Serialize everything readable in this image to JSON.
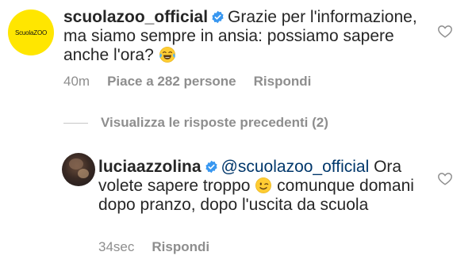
{
  "comment_main": {
    "username": "scuolazoo_official",
    "text": "Grazie per l'informazione, ma siamo sempre in ansia: possiamo sapere anche l'ora?",
    "emoji": "face-with-tears-of-joy",
    "avatar_logo": "ScuolaZOO",
    "time": "40m",
    "likes": "Piace a 282 persone",
    "reply": "Rispondi"
  },
  "view_replies": "Visualizza le risposte precedenti (2)",
  "comment_reply": {
    "username": "luciaazzolina",
    "mention": "@scuolazoo_official",
    "text_before_emoji": "Ora volete sapere troppo",
    "emoji": "winking-face",
    "text_after_emoji": "comunque domani dopo pranzo, dopo l'uscita da scuola",
    "time": "34sec",
    "reply": "Rispondi"
  },
  "colors": {
    "verified": "#3897f0",
    "meta": "#8e8e8e",
    "mention": "#00376b",
    "avatar_bg": "#ffe600"
  }
}
